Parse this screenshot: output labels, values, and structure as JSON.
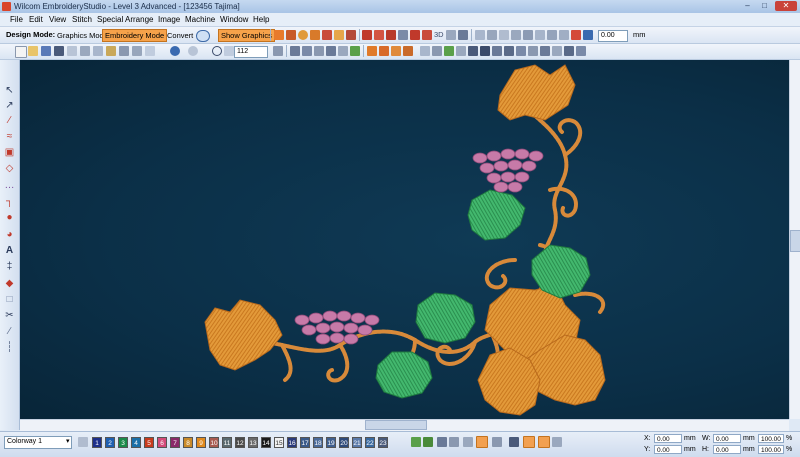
{
  "window": {
    "title": "Wilcom EmbroideryStudio - Level 3 Advanced - [123456      Tajima]",
    "min": "–",
    "max": "□",
    "close": "✕"
  },
  "menu": [
    "File",
    "Edit",
    "View",
    "Stitch",
    "Special",
    "Arrange",
    "Image",
    "Machine",
    "Window",
    "Help"
  ],
  "toolbar": {
    "design_mode_label": "Design Mode:",
    "graphics_mode": "Graphics Mode",
    "embroidery_mode": "Embroidery Mode",
    "convert": "Convert",
    "show_graphics": "Show Graphics",
    "rotate_value": "0.00",
    "rotate_unit": "mm",
    "zoom_value": "112",
    "three_d": "3D"
  },
  "colorway": {
    "name": "Colorway 1",
    "swatches": [
      {
        "n": "1",
        "c": "#1d2f8a"
      },
      {
        "n": "2",
        "c": "#1f5fb0"
      },
      {
        "n": "3",
        "c": "#1a8a4a"
      },
      {
        "n": "4",
        "c": "#1a6fa8"
      },
      {
        "n": "5",
        "c": "#c73b1d"
      },
      {
        "n": "6",
        "c": "#d34b7a"
      },
      {
        "n": "7",
        "c": "#8a2a6a"
      },
      {
        "n": "8",
        "c": "#c98a2a"
      },
      {
        "n": "9",
        "c": "#e08a1e"
      },
      {
        "n": "10",
        "c": "#a85a50"
      },
      {
        "n": "11",
        "c": "#5a6a70"
      },
      {
        "n": "12",
        "c": "#4a4a4a"
      },
      {
        "n": "13",
        "c": "#6a6a6a"
      },
      {
        "n": "14",
        "c": "#1a1a1a"
      },
      {
        "n": "15",
        "c": "#f2f2f2"
      },
      {
        "n": "16",
        "c": "#2a3a7a"
      },
      {
        "n": "17",
        "c": "#3a5a8a"
      },
      {
        "n": "18",
        "c": "#4a6a9a"
      },
      {
        "n": "19",
        "c": "#3f5f8f"
      },
      {
        "n": "20",
        "c": "#2e4a7a"
      },
      {
        "n": "21",
        "c": "#5a7aaa"
      },
      {
        "n": "22",
        "c": "#3a6aa0"
      },
      {
        "n": "23",
        "c": "#4a5a7a"
      }
    ]
  },
  "status": {
    "x_label": "X:",
    "x_value": "0.00",
    "x_unit": "mm",
    "y_label": "Y:",
    "y_value": "0.00",
    "y_unit": "mm",
    "w_label": "W:",
    "w_value": "0.00",
    "w_unit": "mm",
    "h_label": "H:",
    "h_value": "0.00",
    "h_unit": "mm",
    "w_pct": "100.00",
    "h_pct": "100.00",
    "pct": "%"
  },
  "colors": {
    "canvas": "#0c3049",
    "thread_orange": "#e39a3a",
    "thread_green": "#3db36a",
    "thread_pink": "#c77aa8",
    "active_mode": "#f6a24a"
  }
}
